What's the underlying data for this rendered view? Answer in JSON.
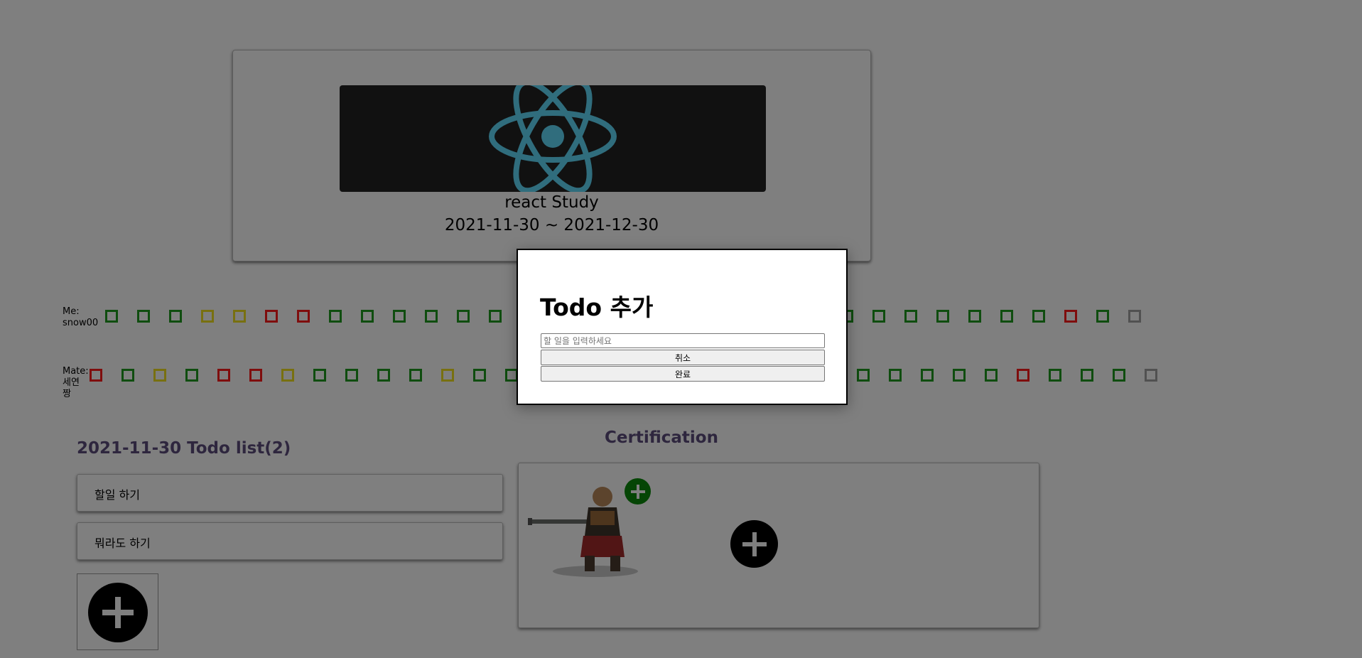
{
  "study": {
    "name": "react Study",
    "period": "2021-11-30 ~ 2021-12-30",
    "banner_icon": "react-logo-icon"
  },
  "progress": {
    "me_label": "Me:",
    "me_name": "snow00",
    "me_boxes": [
      "green",
      "green",
      "green",
      "yellow",
      "yellow",
      "red",
      "red",
      "green",
      "green",
      "green",
      "green",
      "green",
      "green",
      "green",
      "green",
      "green",
      "green",
      "green",
      "green",
      "green",
      "green",
      "green",
      "green",
      "green",
      "green",
      "green",
      "green",
      "green",
      "green",
      "green",
      "red",
      "green",
      "gray"
    ],
    "mate_label": "Mate:",
    "mate_name": "세연짱",
    "mate_boxes": [
      "red",
      "green",
      "yellow",
      "green",
      "red",
      "red",
      "yellow",
      "green",
      "green",
      "green",
      "green",
      "yellow",
      "green",
      "green",
      "green",
      "green",
      "green",
      "green",
      "green",
      "green",
      "green",
      "green",
      "green",
      "green",
      "green",
      "green",
      "green",
      "green",
      "green",
      "red",
      "green",
      "green",
      "green",
      "gray"
    ],
    "colors": {
      "green": "#1f9b1f",
      "red": "#ff1a1a",
      "yellow": "#f0e021",
      "gray": "#a3a3a3"
    }
  },
  "todo": {
    "title": "2021-11-30 Todo list(2)",
    "items": [
      {
        "text": "할일 하기"
      },
      {
        "text": "뭐라도 하기"
      }
    ],
    "add_icon": "plus-circle-icon"
  },
  "certification": {
    "title": "Certification",
    "image": "warrior-character-image",
    "add_icon": "plus-circle-icon"
  },
  "modal": {
    "title": "Todo 추가",
    "input_placeholder": "할 일을 입력하세요",
    "input_value": "",
    "cancel_label": "취소",
    "confirm_label": "완료"
  }
}
